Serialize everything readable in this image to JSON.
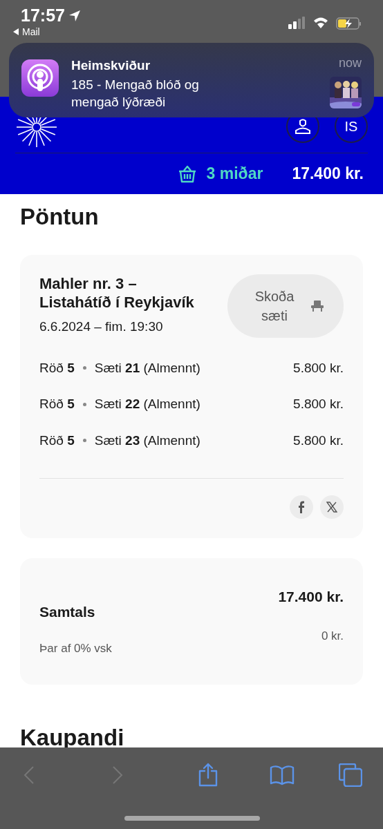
{
  "status_bar": {
    "time": "17:57",
    "back_label": "Mail"
  },
  "notification": {
    "title": "Heimskviður",
    "body": "185 - Mengað blóð og mengað lýðræði",
    "time": "now"
  },
  "header": {
    "language": "IS",
    "cart_count": "3 miðar",
    "cart_total": "17.400 kr."
  },
  "heading": "Pöntun",
  "event": {
    "title": "Mahler nr. 3 – Listahátíð í Reykjavík",
    "date": "6.6.2024 – fim. 19:30",
    "seat_button": "Skoða sæti",
    "tickets": [
      {
        "row": "Röð **5**",
        "seat": "Sæti **21** (Almennt)",
        "price": "5.800 kr."
      },
      {
        "row": "Röð **5**",
        "seat": "Sæti **22** (Almennt)",
        "price": "5.800 kr."
      },
      {
        "row": "Röð **5**",
        "seat": "Sæti **23** (Almennt)",
        "price": "5.800 kr."
      }
    ]
  },
  "summary": {
    "label": "Samtals",
    "total": "17.400 kr.",
    "vat_label": "Þar af 0% vsk",
    "vat": "0 kr."
  },
  "next_heading": "Kaupandi",
  "toolbar": {
    "back": {
      "disabled": true
    },
    "forward": {
      "disabled": true
    }
  }
}
